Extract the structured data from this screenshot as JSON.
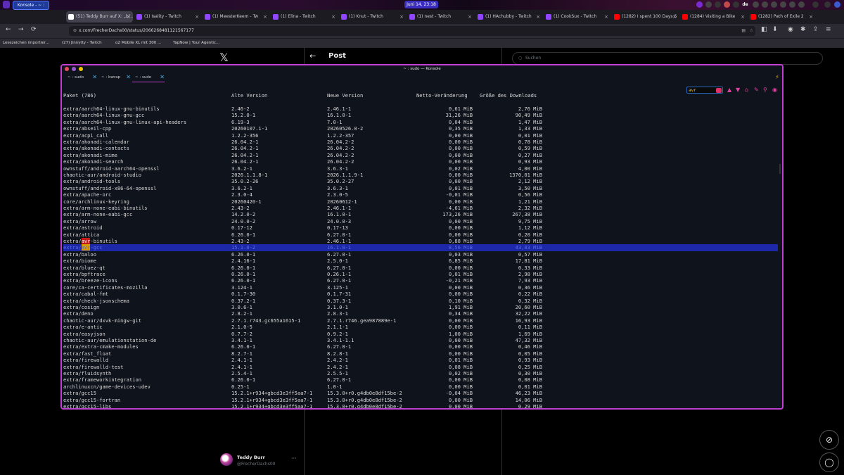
{
  "panel": {
    "konsole_label": "Konsole - ~ : sudo",
    "clock": "Juni 14, 23:18",
    "lang": "de"
  },
  "browser_tabs": [
    {
      "label": "(51) Teddy Burr auf X: „b(…",
      "color": "#ffffff",
      "active": true
    },
    {
      "label": "(1) Isality - Twitch",
      "color": "#9146ff",
      "active": false
    },
    {
      "label": "(1) MeesterKeem - Tw",
      "color": "#9146ff",
      "active": false
    },
    {
      "label": "(1) Elina - Twitch",
      "color": "#9146ff",
      "active": false
    },
    {
      "label": "(1) Knut - Twitch",
      "color": "#9146ff",
      "active": false
    },
    {
      "label": "(1) nest - Twitch",
      "color": "#9146ff",
      "active": false
    },
    {
      "label": "(1) HAchubby - Twitch",
      "color": "#9146ff",
      "active": false
    },
    {
      "label": "(1) CookSux - Twitch",
      "color": "#9146ff",
      "active": false
    },
    {
      "label": "(1282) I spent 100 Days S",
      "color": "#ff0000",
      "active": false
    },
    {
      "label": "(1284) Visiting a Bike",
      "color": "#ff0000",
      "active": false
    },
    {
      "label": "(1282) Path of Exile 2",
      "color": "#ff0000",
      "active": false
    }
  ],
  "url": "x.com/FrecherDachs00/status/2066268481121567177",
  "bookmarks": [
    "Lesezeichen importier…",
    "(27) Jinnytty - Twitch",
    "o2 Mobile XL mit 300 …",
    "TapNow | Your Agentic…"
  ],
  "x_page": {
    "logo": "𝕏",
    "back": "←",
    "title": "Post",
    "search_placeholder": "Suchen",
    "user_name": "Teddy Burr",
    "user_handle": "@FrecherDachs00",
    "more": "···"
  },
  "konsole": {
    "title": "~ : sudo — Konsole",
    "tabs": [
      "~ : sudo",
      "~ : bwrap",
      "~ : sudo"
    ],
    "search_text": "avr",
    "header": {
      "pkg": "Paket (786)",
      "old": "Alte Version",
      "new": "Neue Version",
      "net": "Netto-Veränderung",
      "dl": "Größe des Downloads"
    },
    "rows": [
      {
        "pkg": "extra/aarch64-linux-gnu-binutils",
        "old": "2.46-2",
        "new": "2.46.1-1",
        "net": "0,61 MiB",
        "dl": "2,76 MiB"
      },
      {
        "pkg": "extra/aarch64-linux-gnu-gcc",
        "old": "15.2.0-1",
        "new": "16.1.0-1",
        "net": "31,26 MiB",
        "dl": "90,49 MiB"
      },
      {
        "pkg": "extra/aarch64-linux-gnu-linux-api-headers",
        "old": "6.19-3",
        "new": "7.0-1",
        "net": "0,04 MiB",
        "dl": "1,47 MiB"
      },
      {
        "pkg": "extra/abseil-cpp",
        "old": "20260107.1-1",
        "new": "20260526.0-2",
        "net": "0,35 MiB",
        "dl": "1,33 MiB"
      },
      {
        "pkg": "extra/acpi_call",
        "old": "1.2.2-356",
        "new": "1.2.2-357",
        "net": "0,00 MiB",
        "dl": "0,01 MiB"
      },
      {
        "pkg": "extra/akonadi-calendar",
        "old": "26.04.2-1",
        "new": "26.04.2-2",
        "net": "0,00 MiB",
        "dl": "0,78 MiB"
      },
      {
        "pkg": "extra/akonadi-contacts",
        "old": "26.04.2-1",
        "new": "26.04.2-2",
        "net": "0,00 MiB",
        "dl": "0,59 MiB"
      },
      {
        "pkg": "extra/akonadi-mime",
        "old": "26.04.2-1",
        "new": "26.04.2-2",
        "net": "0,00 MiB",
        "dl": "0,27 MiB"
      },
      {
        "pkg": "extra/akonadi-search",
        "old": "26.04.2-1",
        "new": "26.04.2-2",
        "net": "0,00 MiB",
        "dl": "0,93 MiB"
      },
      {
        "pkg": "ownstuff/android-aarch64-openssl",
        "old": "3.6.2-1",
        "new": "3.6.3-1",
        "net": "0,02 MiB",
        "dl": "4,00 MiB"
      },
      {
        "pkg": "chaotic-aur/android-studio",
        "old": "2026.1.1.8-1",
        "new": "2026.1.1.9-1",
        "net": "0,00 MiB",
        "dl": "1370,01 MiB"
      },
      {
        "pkg": "extra/android-tools",
        "old": "35.0.2-26",
        "new": "35.0.2-27",
        "net": "0,00 MiB",
        "dl": "2,12 MiB"
      },
      {
        "pkg": "ownstuff/android-x86-64-openssl",
        "old": "3.6.2-1",
        "new": "3.6.3-1",
        "net": "0,01 MiB",
        "dl": "3,50 MiB"
      },
      {
        "pkg": "extra/apache-orc",
        "old": "2.3.0-4",
        "new": "2.3.0-5",
        "net": "-0,01 MiB",
        "dl": "0,56 MiB"
      },
      {
        "pkg": "core/archlinux-keyring",
        "old": "20260420-1",
        "new": "20260612-1",
        "net": "0,00 MiB",
        "dl": "1,21 MiB"
      },
      {
        "pkg": "extra/arm-none-eabi-binutils",
        "old": "2.43-2",
        "new": "2.46.1-1",
        "net": "-4,61 MiB",
        "dl": "2,32 MiB"
      },
      {
        "pkg": "extra/arm-none-eabi-gcc",
        "old": "14.2.0-2",
        "new": "16.1.0-1",
        "net": "173,26 MiB",
        "dl": "267,38 MiB"
      },
      {
        "pkg": "extra/arrow",
        "old": "24.0.0-2",
        "new": "24.0.0-3",
        "net": "0,00 MiB",
        "dl": "9,75 MiB"
      },
      {
        "pkg": "extra/astroid",
        "old": "0.17-12",
        "new": "0.17-13",
        "net": "0,00 MiB",
        "dl": "1,12 MiB"
      },
      {
        "pkg": "extra/attica",
        "old": "6.26.0-1",
        "new": "6.27.0-1",
        "net": "0,00 MiB",
        "dl": "0,20 MiB"
      },
      {
        "pkg": "extra/avr-binutils",
        "old": "2.43-2",
        "new": "2.46.1-1",
        "net": "0,88 MiB",
        "dl": "2,79 MiB",
        "hl": "red"
      },
      {
        "pkg": "extra/avr-gcc",
        "old": "15.1.0-2",
        "new": "16.1.0-1",
        "net": "8,56 MiB",
        "dl": "43,83 MiB",
        "hl": "yellow",
        "selected": true
      },
      {
        "pkg": "extra/baloo",
        "old": "6.26.0-1",
        "new": "6.27.0-1",
        "net": "0,03 MiB",
        "dl": "0,57 MiB"
      },
      {
        "pkg": "extra/biome",
        "old": "2.4.16-1",
        "new": "2.5.0-1",
        "net": "6,85 MiB",
        "dl": "17,81 MiB"
      },
      {
        "pkg": "extra/bluez-qt",
        "old": "6.26.0-1",
        "new": "6.27.0-1",
        "net": "0,00 MiB",
        "dl": "0,33 MiB"
      },
      {
        "pkg": "extra/bpftrace",
        "old": "0.26.0-1",
        "new": "0.26.1-1",
        "net": "0,01 MiB",
        "dl": "2,98 MiB"
      },
      {
        "pkg": "extra/breeze-icons",
        "old": "6.26.0-1",
        "new": "6.27.0-1",
        "net": "-0,21 MiB",
        "dl": "7,93 MiB"
      },
      {
        "pkg": "core/ca-certificates-mozilla",
        "old": "3.124-1",
        "new": "3.125-1",
        "net": "0,00 MiB",
        "dl": "0,36 MiB"
      },
      {
        "pkg": "extra/cabal-fmt",
        "old": "0.1.7-30",
        "new": "0.1.7-31",
        "net": "0,00 MiB",
        "dl": "0,22 MiB"
      },
      {
        "pkg": "extra/check-jsonschema",
        "old": "0.37.2-1",
        "new": "0.37.3-1",
        "net": "0,10 MiB",
        "dl": "0,32 MiB"
      },
      {
        "pkg": "extra/cosign",
        "old": "3.0.6-1",
        "new": "3.1.0-1",
        "net": "1,91 MiB",
        "dl": "20,60 MiB"
      },
      {
        "pkg": "extra/deno",
        "old": "2.8.2-1",
        "new": "2.8.3-1",
        "net": "0,34 MiB",
        "dl": "32,22 MiB"
      },
      {
        "pkg": "chaotic-aur/dxvk-mingw-git",
        "old": "2.7.1.r743.gc655a1615-1",
        "new": "2.7.1.r746.gea987889e-1",
        "net": "0,00 MiB",
        "dl": "16,93 MiB"
      },
      {
        "pkg": "extra/e-antic",
        "old": "2.1.0-5",
        "new": "2.1.1-1",
        "net": "0,00 MiB",
        "dl": "0,11 MiB"
      },
      {
        "pkg": "extra/easyjson",
        "old": "0.7.7-2",
        "new": "0.9.2-1",
        "net": "1,00 MiB",
        "dl": "1,69 MiB"
      },
      {
        "pkg": "chaotic-aur/emulationstation-de",
        "old": "3.4.1-1",
        "new": "3.4.1-1.1",
        "net": "0,00 MiB",
        "dl": "47,32 MiB"
      },
      {
        "pkg": "extra/extra-cmake-modules",
        "old": "6.26.0-1",
        "new": "6.27.0-1",
        "net": "0,00 MiB",
        "dl": "0,46 MiB"
      },
      {
        "pkg": "extra/fast_float",
        "old": "8.2.7-1",
        "new": "8.2.8-1",
        "net": "0,00 MiB",
        "dl": "0,05 MiB"
      },
      {
        "pkg": "extra/firewalld",
        "old": "2.4.1-1",
        "new": "2.4.2-1",
        "net": "0,01 MiB",
        "dl": "0,93 MiB"
      },
      {
        "pkg": "extra/firewalld-test",
        "old": "2.4.1-1",
        "new": "2.4.2-1",
        "net": "0,08 MiB",
        "dl": "0,25 MiB"
      },
      {
        "pkg": "extra/fluidsynth",
        "old": "2.5.4-1",
        "new": "2.5.5-1",
        "net": "0,02 MiB",
        "dl": "0,30 MiB"
      },
      {
        "pkg": "extra/frameworkintegration",
        "old": "6.26.0-1",
        "new": "6.27.0-1",
        "net": "0,00 MiB",
        "dl": "0,08 MiB"
      },
      {
        "pkg": "archlinuxcn/game-devices-udev",
        "old": "0.25-1",
        "new": "1.0-1",
        "net": "0,00 MiB",
        "dl": "0,01 MiB"
      },
      {
        "pkg": "extra/gcc15",
        "old": "15.2.1+r934+gbcd3e3ff5aa7-1",
        "new": "15.3.0+r0.g4db0e8df15be-2",
        "net": "-0,04 MiB",
        "dl": "46,23 MiB"
      },
      {
        "pkg": "extra/gcc15-fortran",
        "old": "15.2.1+r934+gbcd3e3ff5aa7-1",
        "new": "15.3.0+r0.g4db0e8df15be-2",
        "net": "0,00 MiB",
        "dl": "14,06 MiB"
      },
      {
        "pkg": "extra/gcc15-libs",
        "old": "15.2.1+r934+gbcd3e3ff5aa7-1",
        "new": "15.3.0+r0.g4db0e8df15be-2",
        "net": "0,00 MiB",
        "dl": "0,29 MiB"
      }
    ]
  }
}
